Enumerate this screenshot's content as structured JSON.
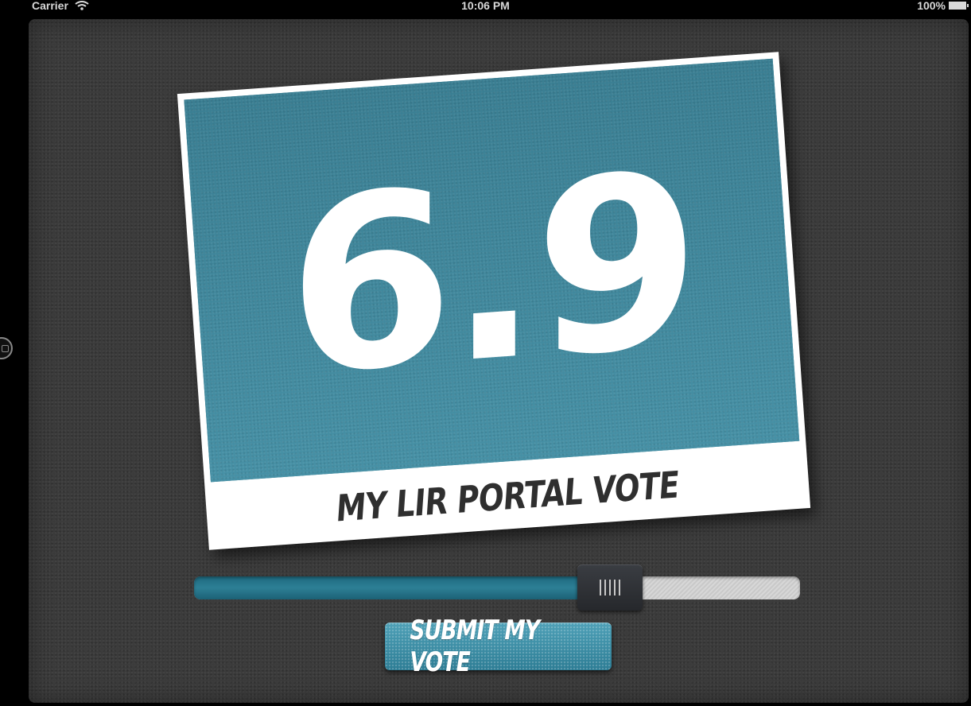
{
  "status_bar": {
    "carrier": "Carrier",
    "time": "10:06 PM",
    "battery": "100%",
    "wifi_icon": "wifi-icon",
    "battery_icon": "battery-icon"
  },
  "card": {
    "vote_value": "6.9",
    "caption": "MY LIR PORTAL VOTE"
  },
  "slider": {
    "value": 6.9,
    "min": 0,
    "max": 10,
    "fill_fraction": 0.69
  },
  "submit": {
    "label": "SUBMIT MY VOTE"
  },
  "colors": {
    "accent": "#3d8396",
    "panel": "#3b3b3b",
    "card": "#ffffff",
    "caption_text": "#2f2f2f"
  }
}
